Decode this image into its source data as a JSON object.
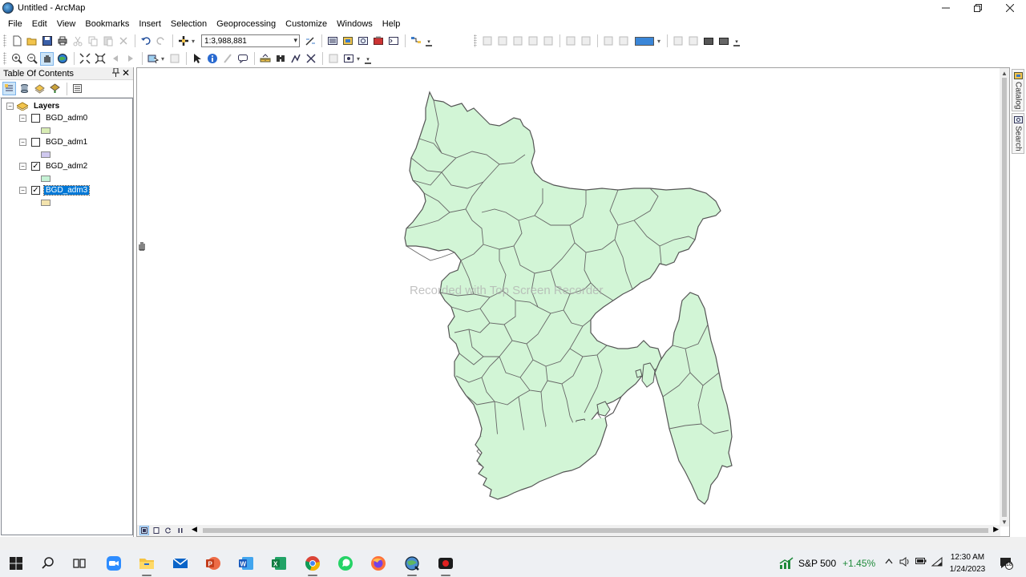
{
  "window": {
    "title": "Untitled - ArcMap",
    "controls": [
      "minimize",
      "restore",
      "close"
    ]
  },
  "menu": [
    "File",
    "Edit",
    "View",
    "Bookmarks",
    "Insert",
    "Selection",
    "Geoprocessing",
    "Customize",
    "Windows",
    "Help"
  ],
  "toolbar": {
    "scale_value": "1:3,988,881",
    "icons_row1": [
      "new-icon",
      "open-icon",
      "save-icon",
      "print-icon",
      "cut-icon",
      "copy-icon",
      "paste-icon",
      "delete-icon",
      "undo-icon",
      "redo-icon",
      "add-data-icon"
    ],
    "icons_row2": [
      "zoom-in-icon",
      "zoom-out-icon",
      "pan-icon",
      "full-extent-icon",
      "fixed-zoom-in-icon",
      "fixed-zoom-out-icon",
      "back-icon",
      "forward-icon",
      "select-features-icon",
      "clear-selection-icon",
      "select-elements-icon",
      "identify-icon",
      "hyperlink-icon",
      "html-popup-icon",
      "measure-icon",
      "find-icon",
      "find-route-icon",
      "go-to-xy-icon",
      "time-slider-icon",
      "viewer-icon"
    ]
  },
  "toc": {
    "title": "Table Of Contents",
    "group_label": "Layers",
    "layers": [
      {
        "name": "BGD_adm0",
        "checked": false,
        "swatch": "#d8ecb4"
      },
      {
        "name": "BGD_adm1",
        "checked": false,
        "swatch": "#cfc8ee"
      },
      {
        "name": "BGD_adm2",
        "checked": true,
        "swatch": "#c5f2d5"
      },
      {
        "name": "BGD_adm3",
        "checked": true,
        "selected": true,
        "swatch": "#f3e3ad"
      }
    ]
  },
  "map": {
    "fill_color": "#d2f5d6",
    "outline_color": "#555555",
    "watermark": "Recorded with Top Screen Recorder"
  },
  "side_tabs": [
    "Catalog",
    "Search"
  ],
  "taskbar": {
    "apps": [
      "start-icon",
      "search-icon",
      "task-view-icon",
      "zoom-icon",
      "file-explorer-icon",
      "mail-icon",
      "powerpoint-icon",
      "word-icon",
      "excel-icon",
      "chrome-icon",
      "whatsapp-icon",
      "firefox-icon",
      "arcmap-icon",
      "recorder-icon"
    ],
    "stock_name": "S&P 500",
    "stock_change": "+1.45%",
    "time": "12:30 AM",
    "date": "1/24/2023",
    "notification_count": "18"
  }
}
